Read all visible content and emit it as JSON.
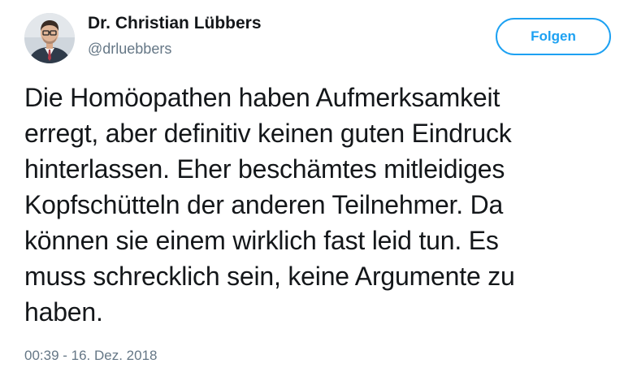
{
  "author": {
    "name": "Dr. Christian Lübbers",
    "handle": "@drluebbers",
    "avatar_icon": "profile-photo"
  },
  "follow_button": {
    "label": "Folgen",
    "color": "#1da1f2"
  },
  "tweet": {
    "lines": [
      "Die Homöopathen haben Aufmerksamkeit",
      "erregt, aber definitiv keinen guten Eindruck",
      "hinterlassen. Eher beschämtes mitleidiges",
      "Kopfschütteln der anderen Teilnehmer. Da",
      "können sie einem wirklich fast leid tun. Es",
      "muss schrecklich sein, keine Argumente zu",
      "haben."
    ],
    "timestamp": "00:39 - 16. Dez. 2018"
  }
}
